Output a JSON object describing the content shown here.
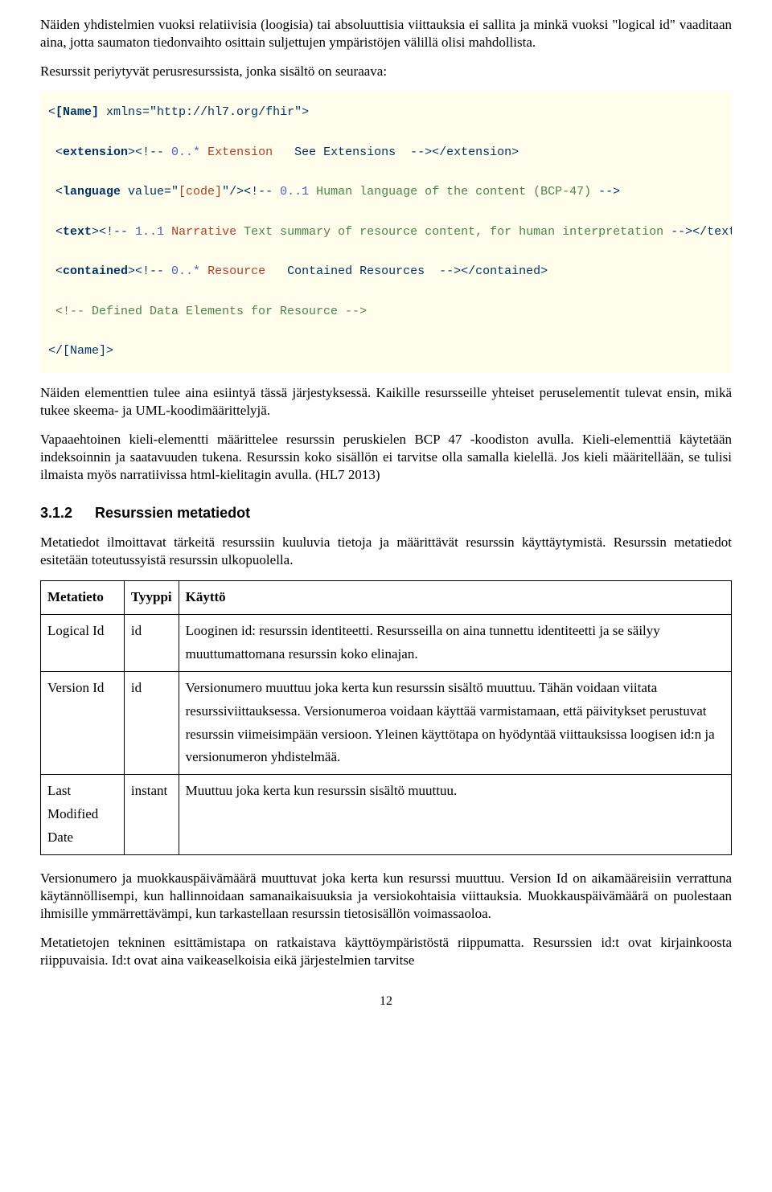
{
  "para1": "Näiden yhdistelmien vuoksi relatiivisia (loogisia) tai absoluuttisia viittauksia ei sallita ja minkä vuoksi \"logical id\" vaaditaan aina, jotta saumaton tiedonvaihto osittain suljettujen ympäristöjen välillä olisi mahdollista.",
  "para2": "Resurssit periytyvät perusresurssista, jonka sisältö on seuraava:",
  "code": {
    "l1a": "<",
    "l1b": "[Name]",
    "l1c": " xmlns=\"http://hl7.org/fhir\">",
    "l2a": " <",
    "l2b": "extension",
    "l2c": "><!-- ",
    "l2d": "0..*",
    "l2e": " Extension",
    "l2f": "   See Extensions  ",
    "l2g": "--></extension>",
    "l3a": " <",
    "l3b": "language",
    "l3c": " value=\"",
    "l3d": "[code]",
    "l3e": "\"/><!-- ",
    "l3f": "0..1",
    "l3g": " Human language of the content (BCP-47) ",
    "l3h": "-->",
    "l4a": " <",
    "l4b": "text",
    "l4c": "><!-- ",
    "l4d": "1..1",
    "l4e": " Narrative",
    "l4f": " Text summary of resource content, for human interpretation ",
    "l4g": "--></text>",
    "l5a": " <",
    "l5b": "contained",
    "l5c": "><!-- ",
    "l5d": "0..*",
    "l5e": " Resource",
    "l5f": "   Contained Resources  ",
    "l5g": "--></contained>",
    "l6a": " <!-- Defined Data Elements for Resource -->",
    "l7a": "</[Name]>"
  },
  "para3": "Näiden elementtien tulee aina esiintyä tässä järjestyksessä. Kaikille resursseille yhteiset peruselementit tulevat ensin, mikä tukee skeema- ja UML-koodimäärittelyjä.",
  "para4": "Vapaaehtoinen kieli-elementti määrittelee resurssin peruskielen BCP 47 -koodiston avulla. Kieli-elementtiä käytetään indeksoinnin ja saatavuuden tukena. Resurssin koko sisällön ei tarvitse olla samalla kielellä. Jos kieli määritellään, se tulisi ilmaista myös narratiivissa html-kielitagin avulla. (HL7 2013)",
  "section": {
    "num": "3.1.2",
    "title": "Resurssien metatiedot"
  },
  "para5": "Metatiedot ilmoittavat tärkeitä resurssiin kuuluvia tietoja ja määrittävät resurssin käyttäytymistä. Resurssin metatiedot esitetään toteutussyistä resurssin ulkopuolella.",
  "table": {
    "headers": [
      "Metatieto",
      "Tyyppi",
      "Käyttö"
    ],
    "rows": [
      {
        "c0": "Logical Id",
        "c1": "id",
        "c2": "Looginen id: resurssin identiteetti. Resursseilla on aina tunnettu identiteetti ja se säilyy muuttumattomana resurssin koko elinajan."
      },
      {
        "c0": "Version Id",
        "c1": "id",
        "c2": "Versionumero muuttuu joka kerta kun resurssin sisältö muuttuu. Tähän voidaan viitata resurssiviittauksessa. Versionumeroa voidaan käyttää varmistamaan, että päivitykset perustuvat resurssin viimeisimpään versioon. Yleinen käyttötapa on hyödyntää viittauksissa loogisen id:n ja versionumeron yhdistelmää."
      },
      {
        "c0": "Last Modified Date",
        "c1": "instant",
        "c2": "Muuttuu joka kerta kun resurssin sisältö muuttuu."
      }
    ]
  },
  "para6": "Versionumero ja muokkauspäivämäärä muuttuvat joka kerta kun resurssi muuttuu. Version Id on aikamääreisiin verrattuna käytännöllisempi, kun hallinnoidaan samanaikaisuuksia ja versiokohtaisia viittauksia. Muokkauspäivämäärä on puolestaan ihmisille ymmärrettävämpi, kun tarkastellaan resurssin tietosisällön voimassaoloa.",
  "para7": "Metatietojen tekninen esittämistapa on ratkaistava käyttöympäristöstä riippumatta. Resurssien id:t ovat kirjainkoosta riippuvaisia. Id:t ovat aina vaikeaselkoisia eikä järjestelmien tarvitse",
  "pagenum": "12"
}
